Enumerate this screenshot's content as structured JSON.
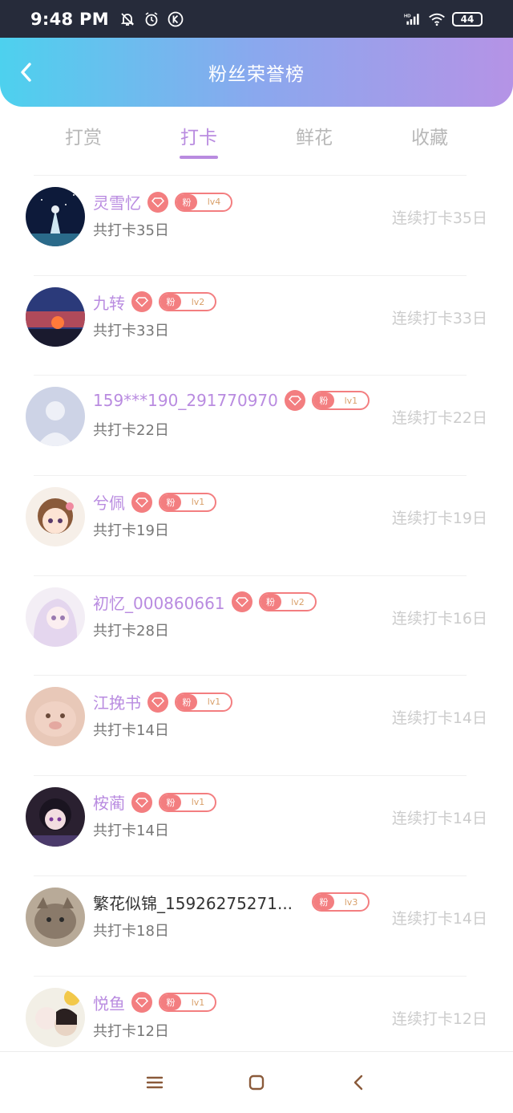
{
  "status": {
    "time": "9:48 PM",
    "battery": "44",
    "icons_left": [
      "mute-bell-icon",
      "alarm-icon",
      "k-icon"
    ],
    "icons_right": [
      "hd-signal-icon",
      "wifi-icon",
      "battery-icon"
    ]
  },
  "header": {
    "title": "粉丝荣誉榜",
    "back_icon": "chevron-left-icon"
  },
  "tabs": [
    {
      "label": "打赏",
      "active": false
    },
    {
      "label": "打卡",
      "active": true
    },
    {
      "label": "鲜花",
      "active": false
    },
    {
      "label": "收藏",
      "active": false
    }
  ],
  "fans": [
    {
      "name": "灵雪忆",
      "has_gem": true,
      "fan": "粉",
      "level": "lv4",
      "total": "共打卡35日",
      "streak": "连续打卡35日"
    },
    {
      "name": "九转",
      "has_gem": true,
      "fan": "粉",
      "level": "lv2",
      "total": "共打卡33日",
      "streak": "连续打卡33日"
    },
    {
      "name": "159***190_291770970",
      "has_gem": true,
      "fan": "粉",
      "level": "lv1",
      "total": "共打卡22日",
      "streak": "连续打卡22日"
    },
    {
      "name": "兮佩",
      "has_gem": true,
      "fan": "粉",
      "level": "lv1",
      "total": "共打卡19日",
      "streak": "连续打卡19日"
    },
    {
      "name": "初忆_000860661",
      "has_gem": true,
      "fan": "粉",
      "level": "lv2",
      "total": "共打卡28日",
      "streak": "连续打卡16日"
    },
    {
      "name": "江挽书",
      "has_gem": true,
      "fan": "粉",
      "level": "lv1",
      "total": "共打卡14日",
      "streak": "连续打卡14日"
    },
    {
      "name": "桉蔺",
      "has_gem": true,
      "fan": "粉",
      "level": "lv1",
      "total": "共打卡14日",
      "streak": "连续打卡14日"
    },
    {
      "name": "繁花似锦_15926275271...",
      "has_gem": false,
      "fan": "粉",
      "level": "lv3",
      "total": "共打卡18日",
      "streak": "连续打卡14日"
    },
    {
      "name": "悦鱼",
      "has_gem": true,
      "fan": "粉",
      "level": "lv1",
      "total": "共打卡12日",
      "streak": "连续打卡12日"
    }
  ],
  "colors": {
    "accent": "#b98be0",
    "badge": "#f37e80",
    "header_start": "#4dd1ee",
    "header_end": "#b593e6"
  },
  "nav": [
    "menu-icon",
    "home-square-icon",
    "back-triangle-icon"
  ]
}
